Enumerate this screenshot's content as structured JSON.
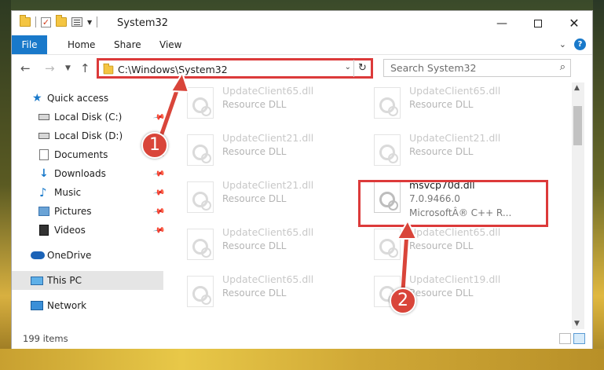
{
  "window": {
    "title": "System32",
    "controls": {
      "minimize": "—",
      "close": "✕"
    }
  },
  "ribbon": {
    "tabs": [
      "File",
      "Home",
      "Share",
      "View"
    ],
    "help": "?"
  },
  "nav": {
    "address": "C:\\Windows\\System32",
    "search_placeholder": "Search System32"
  },
  "sidebar": {
    "items": [
      {
        "label": "Quick access",
        "icon": "star-icon",
        "pinned": false
      },
      {
        "label": "Local Disk (C:)",
        "icon": "drive-icon",
        "pinned": true
      },
      {
        "label": "Local Disk (D:)",
        "icon": "drive-icon",
        "pinned": false
      },
      {
        "label": "Documents",
        "icon": "documents-icon",
        "pinned": true
      },
      {
        "label": "Downloads",
        "icon": "download-icon",
        "pinned": true
      },
      {
        "label": "Music",
        "icon": "music-icon",
        "pinned": true
      },
      {
        "label": "Pictures",
        "icon": "pictures-icon",
        "pinned": true
      },
      {
        "label": "Videos",
        "icon": "videos-icon",
        "pinned": true
      },
      {
        "label": "OneDrive",
        "icon": "cloud-icon",
        "pinned": false
      },
      {
        "label": "This PC",
        "icon": "computer-icon",
        "pinned": false,
        "selected": true
      },
      {
        "label": "Network",
        "icon": "network-icon",
        "pinned": false
      }
    ]
  },
  "files": [
    {
      "name": "UpdateClient65.dll",
      "desc": "Resource DLL"
    },
    {
      "name": "UpdateClient65.dll",
      "desc": "Resource DLL"
    },
    {
      "name": "UpdateClient21.dll",
      "desc": "Resource DLL"
    },
    {
      "name": "UpdateClient21.dll",
      "desc": "Resource DLL"
    },
    {
      "name": "UpdateClient21.dll",
      "desc": "Resource DLL"
    },
    {
      "name": "msvcp70d.dll",
      "desc": "7.0.9466.0",
      "desc2": "MicrosoftÂ® C++ R..."
    },
    {
      "name": "UpdateClient65.dll",
      "desc": "Resource DLL"
    },
    {
      "name": "UpdateClient65.dll",
      "desc": "Resource DLL"
    },
    {
      "name": "UpdateClient65.dll",
      "desc": "Resource DLL"
    },
    {
      "name": "UpdateClient19.dll",
      "desc": "Resource DLL"
    }
  ],
  "status": {
    "item_count": "199 items"
  },
  "callouts": [
    "1",
    "2"
  ],
  "colors": {
    "accent": "#1979ca",
    "highlight": "#dc3a3a"
  }
}
